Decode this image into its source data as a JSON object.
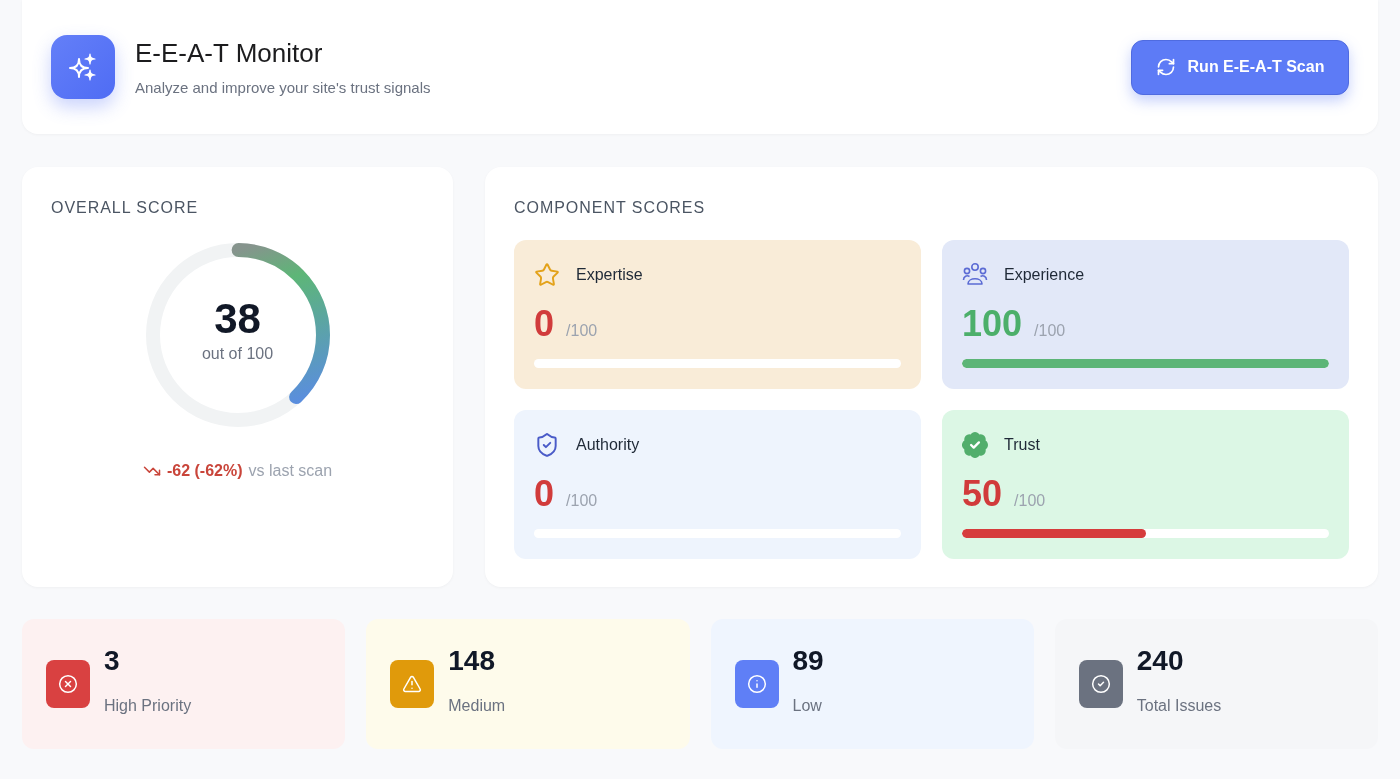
{
  "header": {
    "title": "E-E-A-T Monitor",
    "subtitle": "Analyze and improve your site's trust signals",
    "scan_button": "Run E-E-A-T Scan"
  },
  "overall_score": {
    "heading": "OVERALL SCORE",
    "score": "38",
    "out_of": "out of 100",
    "level": 0.38,
    "change": "-62 (-62%)",
    "change_suffix": "vs last scan"
  },
  "component_scores": {
    "heading": "COMPONENT SCORES",
    "items": [
      {
        "label": "Expertise",
        "score": "0",
        "max": "/100",
        "level": 0
      },
      {
        "label": "Experience",
        "score": "100",
        "max": "/100",
        "level": 1
      },
      {
        "label": "Authority",
        "score": "0",
        "max": "/100",
        "level": 0
      },
      {
        "label": "Trust",
        "score": "50",
        "max": "/100",
        "level": 0.5
      }
    ]
  },
  "issue_summary": [
    {
      "count": "3",
      "label": "High Priority"
    },
    {
      "count": "148",
      "label": "Medium"
    },
    {
      "count": "89",
      "label": "Low"
    },
    {
      "count": "240",
      "label": "Total Issues"
    }
  ]
}
